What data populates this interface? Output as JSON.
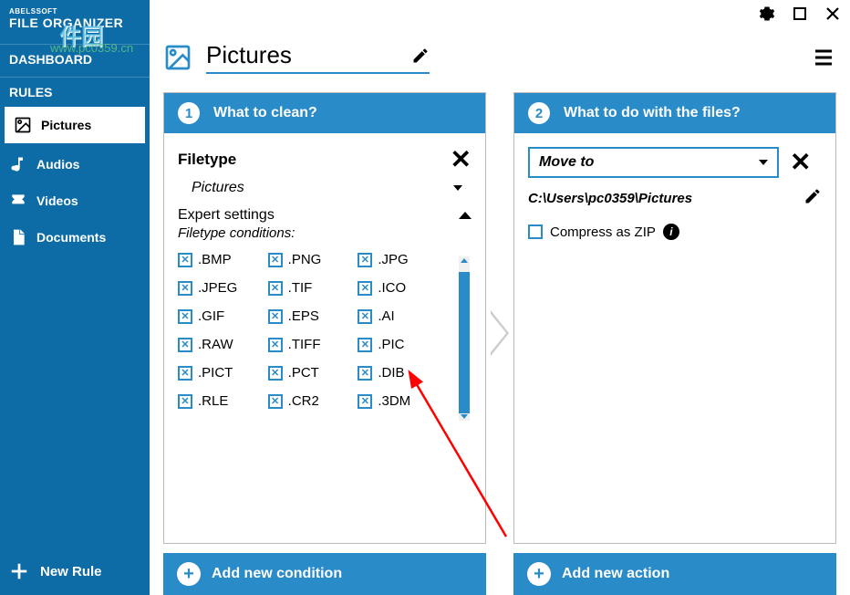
{
  "app": {
    "brand_line1": "ABELSSOFT",
    "brand_line2": "FILE ORGANIZER"
  },
  "watermark": {
    "text1": "件园",
    "text2": "www.pc0359.cn"
  },
  "sidebar": {
    "dashboard_label": "DASHBOARD",
    "rules_label": "RULES",
    "items": [
      {
        "label": "Pictures",
        "active": true
      },
      {
        "label": "Audios",
        "active": false
      },
      {
        "label": "Videos",
        "active": false
      },
      {
        "label": "Documents",
        "active": false
      }
    ],
    "new_rule_label": "New Rule"
  },
  "page": {
    "title": "Pictures"
  },
  "panel1": {
    "step": "1",
    "header": "What to clean?",
    "filetype_label": "Filetype",
    "filetype_value": "Pictures",
    "expert_label": "Expert settings",
    "conditions_label": "Filetype conditions:",
    "extensions": [
      ".BMP",
      ".PNG",
      ".JPG",
      ".JPEG",
      ".TIF",
      ".ICO",
      ".GIF",
      ".EPS",
      ".AI",
      ".RAW",
      ".TIFF",
      ".PIC",
      ".PICT",
      ".PCT",
      ".DIB",
      ".RLE",
      ".CR2",
      ".3DM"
    ],
    "add_condition_label": "Add new condition"
  },
  "panel2": {
    "step": "2",
    "header": "What to do with the files?",
    "action_value": "Move to",
    "path": "C:\\Users\\pc0359\\Pictures",
    "compress_label": "Compress as ZIP",
    "add_action_label": "Add new action"
  }
}
